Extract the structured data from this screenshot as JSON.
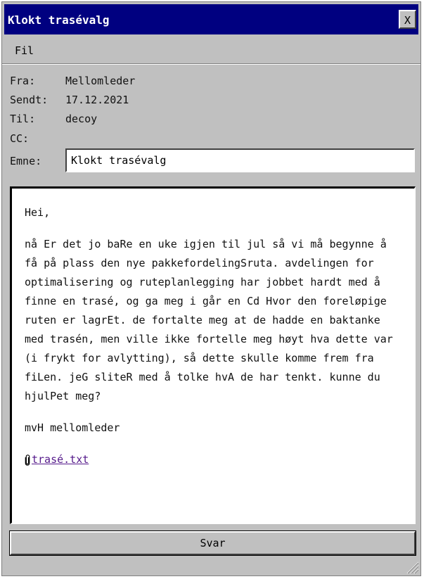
{
  "window": {
    "title": "Klokt trasévalg",
    "close_label": "X"
  },
  "menu": {
    "items": [
      {
        "label": "Fil"
      }
    ]
  },
  "header": {
    "from_label": "Fra:",
    "from_value": "Mellomleder",
    "sent_label": "Sendt:",
    "sent_value": "17.12.2021",
    "to_label": "Til:",
    "to_value": "decoy",
    "cc_label": "CC:",
    "cc_value": "",
    "subject_label": "Emne:",
    "subject_value": "Klokt trasévalg"
  },
  "body": {
    "greeting": "Hei,",
    "paragraph": "nå Er det jo baRe en uke igjen til jul så vi må begynne å få på plass den nye pakkefordelingSruta. avdelingen for optimalisering og ruteplanlegging har jobbet hardt med å finne en trasé, og ga meg i går en Cd Hvor den foreløpige ruten er lagrEt. de fortalte meg at de hadde en baktanke med trasén, men ville ikke fortelle meg høyt hva dette var (i frykt for avlytting), så dette skulle komme frem fra fiLen. jeG sliteR med å tolke hvA de har tenkt. kunne du hjulPet meg?",
    "signoff": "mvH mellomleder",
    "attachment_name": "trasé.txt",
    "attachment_icon": "paperclip-icon"
  },
  "actions": {
    "reply_label": "Svar"
  },
  "colors": {
    "titlebar": "#000080",
    "window": "#c0c0c0",
    "link": "#551a8b"
  }
}
